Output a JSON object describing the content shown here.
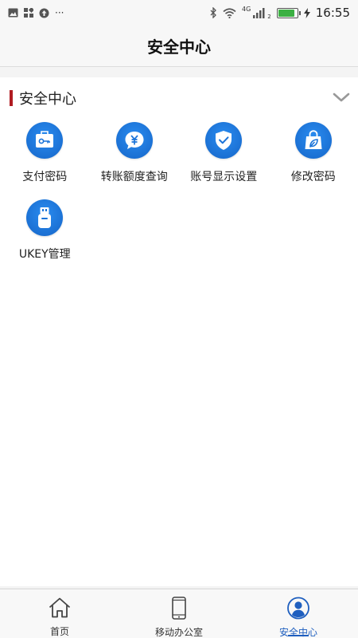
{
  "status_bar": {
    "time": "16:55",
    "network": "4G",
    "signal_sub": "2",
    "battery_level": 0.9,
    "left_icons": [
      "image-icon",
      "apps-icon",
      "upload-icon",
      "more-dots-icon"
    ],
    "more_text": "···"
  },
  "nav": {
    "title": "安全中心"
  },
  "section": {
    "title": "安全中心",
    "accent_color": "#b01c22",
    "items": [
      {
        "label": "支付密码",
        "icon": "payment-key-icon"
      },
      {
        "label": "转账额度查询",
        "icon": "yuan-chat-icon"
      },
      {
        "label": "账号显示设置",
        "icon": "shield-check-icon"
      },
      {
        "label": "修改密码",
        "icon": "bag-leaf-icon"
      },
      {
        "label": "UKEY管理",
        "icon": "usb-key-icon"
      }
    ]
  },
  "tabs": [
    {
      "label": "首页",
      "icon": "home-icon",
      "active": false
    },
    {
      "label": "移动办公室",
      "icon": "phone-icon",
      "active": false
    },
    {
      "label": "安全中心",
      "icon": "user-circle-icon",
      "active": true
    }
  ],
  "colors": {
    "icon_blue": "#1a73d9",
    "active_tab": "#1f5fbf"
  }
}
